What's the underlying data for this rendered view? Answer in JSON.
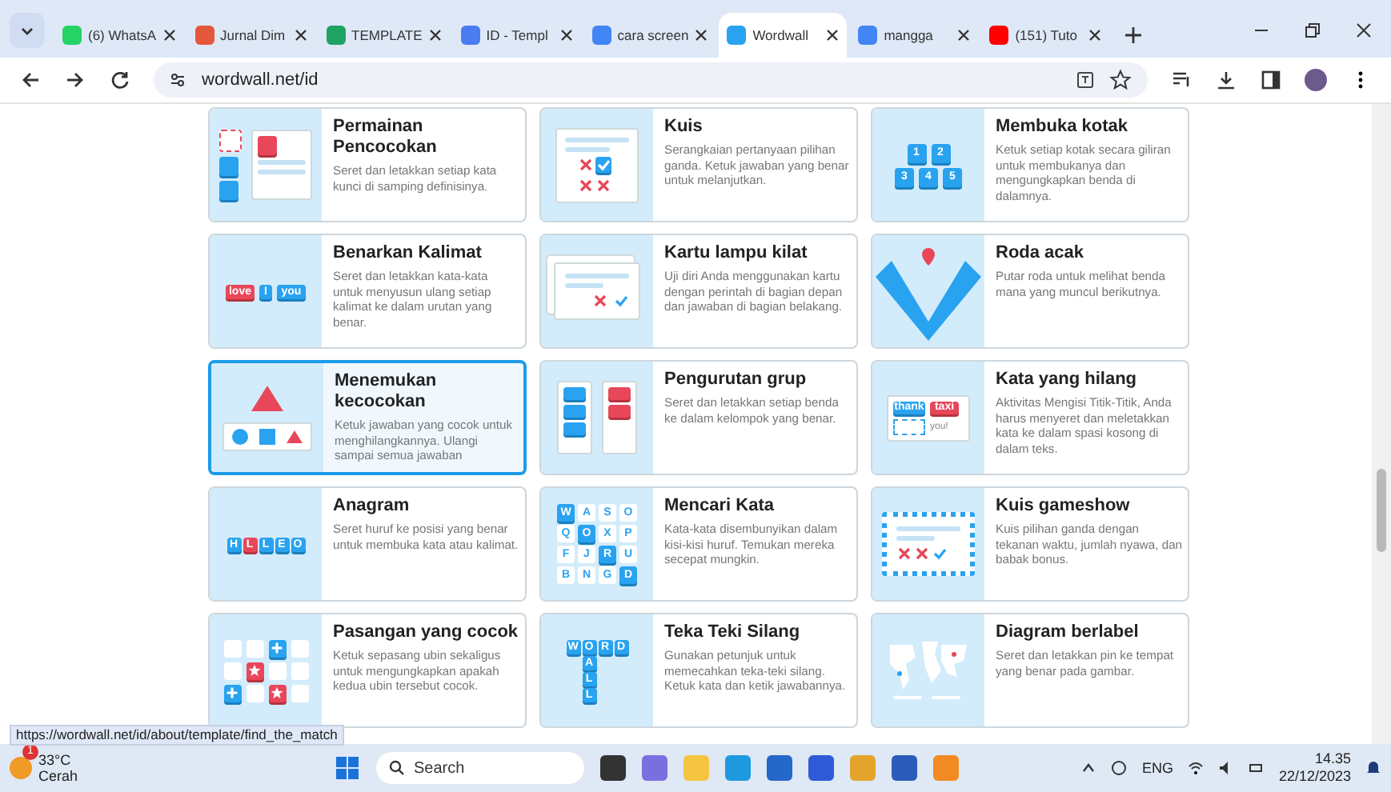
{
  "browser": {
    "tabs": [
      {
        "title": "(6) WhatsA",
        "selected": false
      },
      {
        "title": "Jurnal Dim",
        "selected": false
      },
      {
        "title": "TEMPLATE",
        "selected": false
      },
      {
        "title": "ID - Templ",
        "selected": false
      },
      {
        "title": "cara screen",
        "selected": false
      },
      {
        "title": "Wordwall",
        "selected": true
      },
      {
        "title": "mangga",
        "selected": false
      },
      {
        "title": "(151) Tuto",
        "selected": false
      }
    ],
    "address": "wordwall.net/id"
  },
  "cards": [
    {
      "kind": "match",
      "title": "Permainan Pencocokan",
      "description": "Seret dan letakkan setiap kata kunci di samping definisinya.",
      "selected": false
    },
    {
      "kind": "quiz",
      "title": "Kuis",
      "description": "Serangkaian pertanyaan pilihan ganda. Ketuk jawaban yang benar untuk melanjutkan.",
      "selected": false
    },
    {
      "kind": "boxes",
      "title": "Membuka kotak",
      "description": "Ketuk setiap kotak secara giliran untuk membukanya dan mengungkapkan benda di dalamnya.",
      "selected": false,
      "thumbnail_labels": [
        "1",
        "2",
        "3",
        "4",
        "5"
      ]
    },
    {
      "kind": "sentence",
      "title": "Benarkan Kalimat",
      "description": "Seret dan letakkan kata-kata untuk menyusun ulang setiap kalimat ke dalam urutan yang benar.",
      "selected": false,
      "thumbnail_labels": [
        "love",
        "I",
        "you"
      ]
    },
    {
      "kind": "flashcards",
      "title": "Kartu lampu kilat",
      "description": "Uji diri Anda menggunakan kartu dengan perintah di bagian depan dan jawaban di bagian belakang.",
      "selected": false
    },
    {
      "kind": "wheel",
      "title": "Roda acak",
      "description": "Putar roda untuk melihat benda mana yang muncul berikutnya.",
      "selected": false
    },
    {
      "kind": "findmatch",
      "title": "Menemukan kecocokan",
      "description": "Ketuk jawaban yang cocok untuk menghilangkannya. Ulangi sampai semua jawaban",
      "selected": true
    },
    {
      "kind": "groupsort",
      "title": "Pengurutan grup",
      "description": "Seret dan letakkan setiap benda ke dalam kelompok yang benar.",
      "selected": false
    },
    {
      "kind": "missingword",
      "title": "Kata yang hilang",
      "description": "Aktivitas Mengisi Titik-Titik, Anda harus menyeret dan meletakkan kata ke dalam spasi kosong di dalam teks.",
      "selected": false,
      "thumbnail_labels": [
        "thank",
        "taxi",
        "you!"
      ]
    },
    {
      "kind": "anagram",
      "title": "Anagram",
      "description": "Seret huruf ke posisi yang benar untuk membuka kata atau kalimat.",
      "selected": false,
      "thumbnail_labels": [
        "H",
        "L",
        "L",
        "E",
        "O"
      ]
    },
    {
      "kind": "wordsearch",
      "title": "Mencari Kata",
      "description": "Kata-kata disembunyikan dalam kisi-kisi huruf. Temukan mereka secepat mungkin.",
      "selected": false,
      "thumbnail_labels": [
        "W",
        "A",
        "S",
        "O",
        "Q",
        "O",
        "X",
        "P",
        "F",
        "J",
        "R",
        "U",
        "B",
        "N",
        "G",
        "D"
      ]
    },
    {
      "kind": "gameshow",
      "title": "Kuis gameshow",
      "description": "Kuis pilihan ganda dengan tekanan waktu, jumlah nyawa, dan babak bonus.",
      "selected": false
    },
    {
      "kind": "pairs",
      "title": "Pasangan yang cocok",
      "description": "Ketuk sepasang ubin sekaligus untuk mengungkapkan apakah kedua ubin tersebut cocok.",
      "selected": false
    },
    {
      "kind": "crossword",
      "title": "Teka Teki Silang",
      "description": "Gunakan petunjuk untuk memecahkan teka-teki silang. Ketuk kata dan ketik jawabannya.",
      "selected": false,
      "thumbnail_labels": [
        "W",
        "O",
        "R",
        "D",
        "A",
        "L",
        "L"
      ]
    },
    {
      "kind": "diagram",
      "title": "Diagram berlabel",
      "description": "Seret dan letakkan pin ke tempat yang benar pada gambar.",
      "selected": false
    }
  ],
  "status_url": "https://wordwall.net/id/about/template/find_the_match",
  "taskbar": {
    "weather_badge": "1",
    "temperature": "33°C",
    "condition": "Cerah",
    "search_placeholder": "Search",
    "language": "ENG",
    "time": "14.35",
    "date": "22/12/2023"
  }
}
